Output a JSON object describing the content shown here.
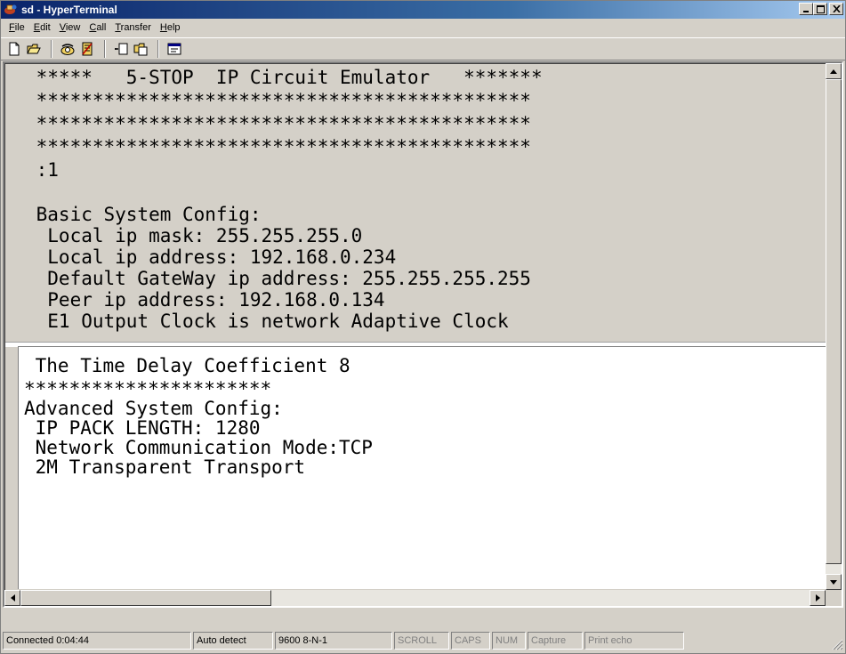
{
  "window": {
    "title": "sd - HyperTerminal",
    "controls": {
      "minimize": "_",
      "maximize": "□",
      "close": "×"
    }
  },
  "menu": [
    {
      "label": "File",
      "accel": "F",
      "rest": "ile"
    },
    {
      "label": "Edit",
      "accel": "E",
      "rest": "dit"
    },
    {
      "label": "View",
      "accel": "V",
      "rest": "iew"
    },
    {
      "label": "Call",
      "accel": "C",
      "rest": "all"
    },
    {
      "label": "Transfer",
      "accel": "T",
      "rest": "ransfer"
    },
    {
      "label": "Help",
      "accel": "H",
      "rest": "elp"
    }
  ],
  "toolbar": {
    "buttons": [
      "new-icon",
      "open-icon",
      "call-icon",
      "disconnect-icon",
      "send-icon",
      "receive-icon",
      "properties-icon"
    ]
  },
  "terminal": {
    "upper_lines": [
      " *****   5-STOP  IP Circuit Emulator   *******",
      " ********************************************",
      " ********************************************",
      " ********************************************",
      " :1",
      "",
      " Basic System Config:",
      "  Local ip mask: 255.255.255.0",
      "  Local ip address: 192.168.0.234",
      "  Default GateWay ip address: 255.255.255.255",
      "  Peer ip address: 192.168.0.134",
      "  E1 Output Clock is network Adaptive Clock"
    ],
    "lower_lines": [
      " The Time Delay Coefficient 8",
      "**********************",
      "Advanced System Config:",
      " IP PACK LENGTH: 1280",
      " Network Communication Mode:TCP",
      " 2M Transparent Transport"
    ]
  },
  "statusbar": {
    "connected": "Connected 0:04:44",
    "detect": "Auto detect",
    "settings": "9600 8-N-1",
    "scroll": "SCROLL",
    "caps": "CAPS",
    "num": "NUM",
    "capture": "Capture",
    "print_echo": "Print echo"
  }
}
